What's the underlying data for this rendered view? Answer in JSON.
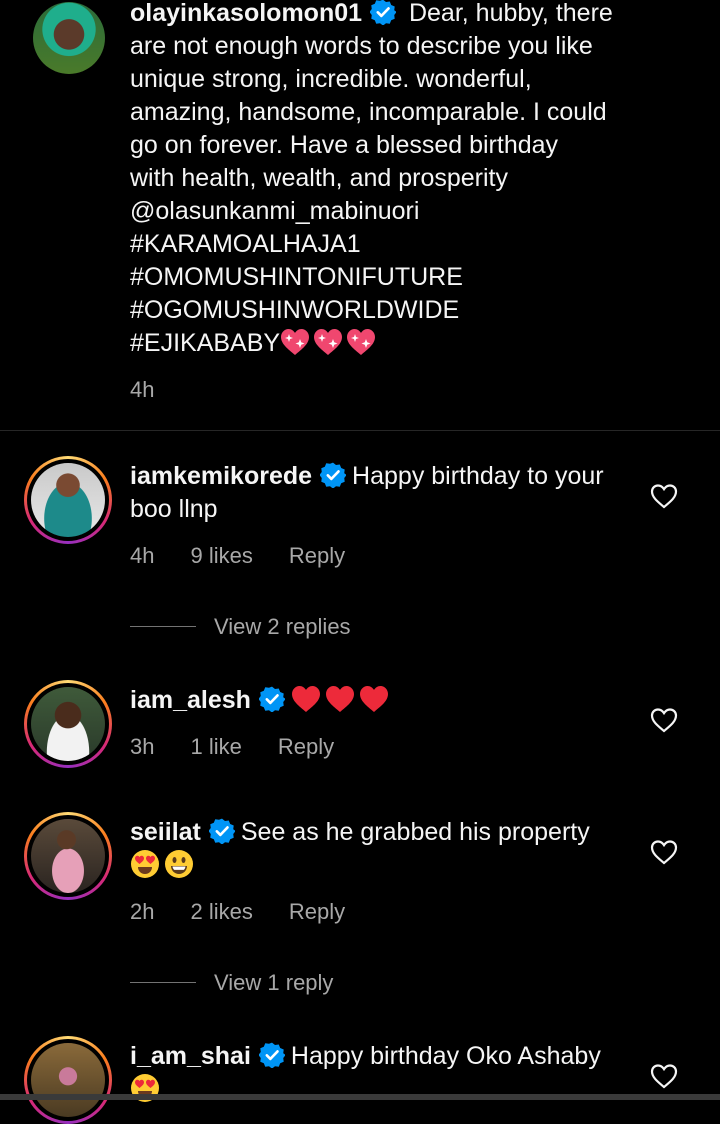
{
  "post": {
    "username": "olayinkasolomon01",
    "lines": [
      " Dear, hubby, there",
      "are not enough words to describe you like",
      "unique strong, incredible. wonderful,",
      "amazing, handsome, incomparable. I could",
      "go on forever. Have a blessed birthday",
      "with health, wealth, and prosperity",
      "@olasunkanmi_mabinuori",
      "#KARAMOALHAJA1",
      "#OMOMUSHINTONIFUTURE",
      "#OGOMUSHINWORLDWIDE",
      "#EJIKABABY"
    ],
    "time": "4h"
  },
  "comments": [
    {
      "username": "iamkemikorede",
      "text_line1": "Happy birthday to your",
      "text_line2": "boo llnp",
      "time": "4h",
      "likes": "9 likes",
      "reply": "Reply",
      "view_replies": "View 2 replies"
    },
    {
      "username": "iam_alesh",
      "time": "3h",
      "likes": "1 like",
      "reply": "Reply"
    },
    {
      "username": "seiilat",
      "text_line1": "See as he grabbed his property",
      "time": "2h",
      "likes": "2 likes",
      "reply": "Reply",
      "view_replies": "View 1 reply"
    },
    {
      "username": "i_am_shai",
      "text_line1": "Happy birthday Oko Ashaby"
    }
  ],
  "icons": {
    "verified": "verified-badge-icon",
    "like": "heart-outline-icon",
    "red_heart": "red-heart-emoji",
    "sparkling_heart": "sparkling-heart-emoji",
    "heart_eyes": "heart-eyes-emoji",
    "smile": "grinning-face-emoji"
  },
  "colors": {
    "background": "#000000",
    "text": "#f5f5f5",
    "secondary": "#a8a8a8",
    "verified": "#0095f6",
    "heart": "#ed2a3a"
  }
}
